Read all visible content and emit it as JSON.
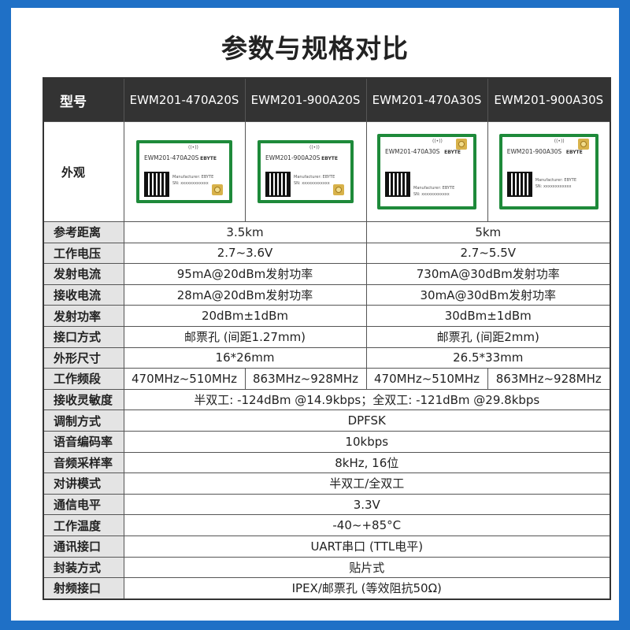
{
  "title": "参数与规格对比",
  "header": {
    "label": "型号",
    "models": [
      "EWM201-470A20S",
      "EWM201-900A20S",
      "EWM201-470A30S",
      "EWM201-900A30S"
    ]
  },
  "appearance": {
    "label": "外观",
    "modules": [
      {
        "name": "EWM201-470A20S",
        "brand": "EBYTE",
        "manufacturer": "Manufacturer: EBYTE",
        "sn": "SN: xxxxxxxxxxxx"
      },
      {
        "name": "EWM201-900A20S",
        "brand": "EBYTE",
        "manufacturer": "Manufacturer: EBYTE",
        "sn": "SN: xxxxxxxxxxxx"
      },
      {
        "name": "EWM201-470A30S",
        "brand": "EBYTE",
        "manufacturer": "Manufacturer: EBYTE",
        "sn": "SN: xxxxxxxxxxxx"
      },
      {
        "name": "EWM201-900A30S",
        "brand": "EBYTE",
        "manufacturer": "Manufacturer: EBYTE",
        "sn": "SN: xxxxxxxxxxxx"
      }
    ]
  },
  "rows": {
    "distance": {
      "label": "参考距离",
      "a20": "3.5km",
      "a30": "5km"
    },
    "voltage": {
      "label": "工作电压",
      "a20": "2.7~3.6V",
      "a30": "2.7~5.5V"
    },
    "tx_current": {
      "label": "发射电流",
      "a20": "95mA@20dBm发射功率",
      "a30": "730mA@30dBm发射功率"
    },
    "rx_current": {
      "label": "接收电流",
      "a20": "28mA@20dBm发射功率",
      "a30": "30mA@30dBm发射功率"
    },
    "tx_power": {
      "label": "发射功率",
      "a20": "20dBm±1dBm",
      "a30": "30dBm±1dBm"
    },
    "interface_type": {
      "label": "接口方式",
      "a20": "邮票孔 (间距1.27mm)",
      "a30": "邮票孔 (间距2mm)"
    },
    "size": {
      "label": "外形尺寸",
      "a20": "16*26mm",
      "a30": "26.5*33mm"
    },
    "band": {
      "label": "工作频段",
      "v1": "470MHz~510MHz",
      "v2": "863MHz~928MHz",
      "v3": "470MHz~510MHz",
      "v4": "863MHz~928MHz"
    },
    "sensitivity": {
      "label": "接收灵敏度",
      "value": "半双工: -124dBm @14.9kbps；全双工: -121dBm @29.8kbps"
    },
    "modulation": {
      "label": "调制方式",
      "value": "DPFSK"
    },
    "voice_rate": {
      "label": "语音编码率",
      "value": "10kbps"
    },
    "audio_sampling": {
      "label": "音频采样率",
      "value": "8kHz, 16位"
    },
    "intercom_mode": {
      "label": "对讲模式",
      "value": "半双工/全双工"
    },
    "logic_level": {
      "label": "通信电平",
      "value": "3.3V"
    },
    "temperature": {
      "label": "工作温度",
      "value": "-40~+85°C"
    },
    "comm_interface": {
      "label": "通讯接口",
      "value": "UART串口 (TTL电平)"
    },
    "package": {
      "label": "封装方式",
      "value": "贴片式"
    },
    "rf_interface": {
      "label": "射频接口",
      "value": "IPEX/邮票孔 (等效阻抗50Ω)"
    }
  }
}
